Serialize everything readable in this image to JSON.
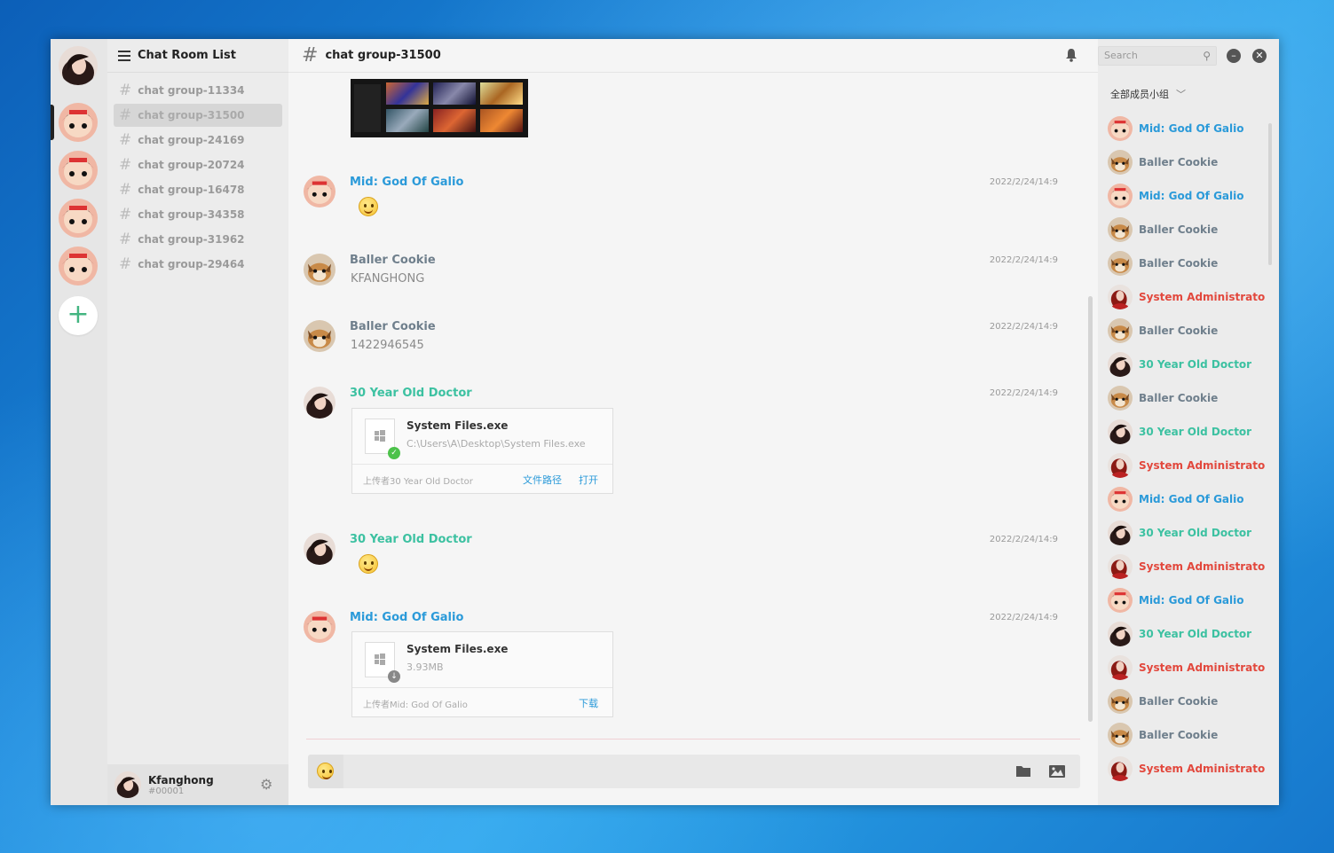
{
  "rail": {
    "server_count": 5
  },
  "channels": {
    "title": "Chat Room List",
    "items": [
      {
        "label": "chat group-11334"
      },
      {
        "label": "chat group-31500",
        "active": true
      },
      {
        "label": "chat group-24169"
      },
      {
        "label": "chat group-20724"
      },
      {
        "label": "chat group-16478"
      },
      {
        "label": "chat group-34358"
      },
      {
        "label": "chat group-31962"
      },
      {
        "label": "chat group-29464"
      }
    ]
  },
  "user": {
    "name": "Kfanghong",
    "tag": "#00001"
  },
  "main": {
    "title": "chat group-31500"
  },
  "messages": [
    {
      "author": "Mid: God Of Galio",
      "time": "2022/2/24/14:9",
      "kind": "emoji"
    },
    {
      "author": "Baller Cookie",
      "time": "2022/2/24/14:9",
      "text": "KFANGHONG"
    },
    {
      "author": "Baller Cookie",
      "time": "2022/2/24/14:9",
      "text": "1422946545"
    },
    {
      "author": "30 Year Old Doctor",
      "time": "2022/2/24/14:9",
      "file": {
        "name": "System Files.exe",
        "sub": "C:\\Users\\A\\Desktop\\System Files.exe",
        "by": "上传者30 Year Old Doctor",
        "link1": "文件路径",
        "link2": "打开"
      }
    },
    {
      "author": "30 Year Old Doctor",
      "time": "2022/2/24/14:9",
      "kind": "emoji"
    },
    {
      "author": "Mid: God Of Galio",
      "time": "2022/2/24/14:9",
      "file": {
        "name": "System Files.exe",
        "sub": "3.93MB",
        "by": "上传者Mid: God Of Galio",
        "link1": "下载"
      }
    }
  ],
  "members": {
    "search_placeholder": "Search",
    "group_label": "全部成员小组",
    "list": [
      "Mid: God Of Galio",
      "Baller Cookie",
      "Mid: God Of Galio",
      "Baller Cookie",
      "Baller Cookie",
      "System Administrato",
      "Baller Cookie",
      "30 Year Old Doctor",
      "Baller Cookie",
      "30 Year Old Doctor",
      "System Administrato",
      "Mid: God Of Galio",
      "30 Year Old Doctor",
      "System Administrato",
      "Mid: God Of Galio",
      "30 Year Old Doctor",
      "System Administrato",
      "Baller Cookie",
      "Baller Cookie",
      "System Administrato"
    ]
  },
  "colors": {
    "mid": "#2b9ad9",
    "baller": "#6f7f8c",
    "doctor": "#3cc1a1",
    "admin": "#e2483d",
    "accent": "#43b581"
  },
  "icons": [
    "list-icon",
    "plus-icon",
    "hash-icon",
    "bell-icon",
    "search-icon",
    "minimize-icon",
    "close-icon",
    "gear-icon",
    "emoji-icon",
    "folder-icon",
    "image-icon",
    "windows-file-icon",
    "check-icon",
    "download-icon",
    "chevron-down-icon"
  ]
}
